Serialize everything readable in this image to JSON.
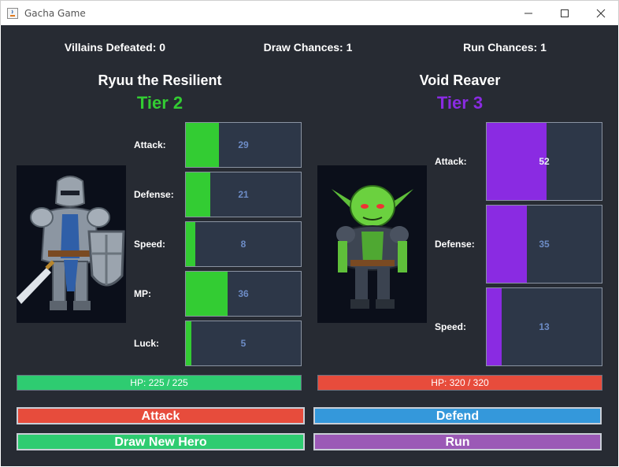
{
  "window": {
    "title": "Gacha Game"
  },
  "top_stats": {
    "villains_defeated": "Villains Defeated: 0",
    "draw_chances": "Draw Chances: 1",
    "run_chances": "Run Chances: 1"
  },
  "hero": {
    "name": "Ryuu the Resilient",
    "tier": "Tier 2",
    "tier_color": "#33cc33",
    "portrait_icon": "armored-knight-icon",
    "stats": [
      {
        "label": "Attack:",
        "value": "29",
        "fill": 0.29
      },
      {
        "label": "Defense:",
        "value": "21",
        "fill": 0.21
      },
      {
        "label": "Speed:",
        "value": "8",
        "fill": 0.08
      },
      {
        "label": "MP:",
        "value": "36",
        "fill": 0.36
      },
      {
        "label": "Luck:",
        "value": "5",
        "fill": 0.05
      }
    ],
    "hp_text": "HP: 225 / 225",
    "hp_color": "#2ecc71"
  },
  "villain": {
    "name": "Void Reaver",
    "tier": "Tier 3",
    "tier_color": "#8a2be2",
    "portrait_icon": "goblin-icon",
    "stats": [
      {
        "label": "Attack:",
        "value": "52",
        "fill": 0.52
      },
      {
        "label": "Defense:",
        "value": "35",
        "fill": 0.35
      },
      {
        "label": "Speed:",
        "value": "13",
        "fill": 0.13
      }
    ],
    "hp_text": "HP: 320 / 320",
    "hp_color": "#e74c3c"
  },
  "actions": {
    "attack": "Attack",
    "defend": "Defend",
    "draw_new_hero": "Draw New Hero",
    "run": "Run"
  },
  "colors": {
    "background": "#272b33",
    "hero_fill": "#33cc33",
    "villain_fill": "#8a2be2",
    "attack_button": "#e74c3c",
    "defend_button": "#3498db",
    "draw_button": "#2ecc71",
    "run_button": "#9b59b6"
  }
}
